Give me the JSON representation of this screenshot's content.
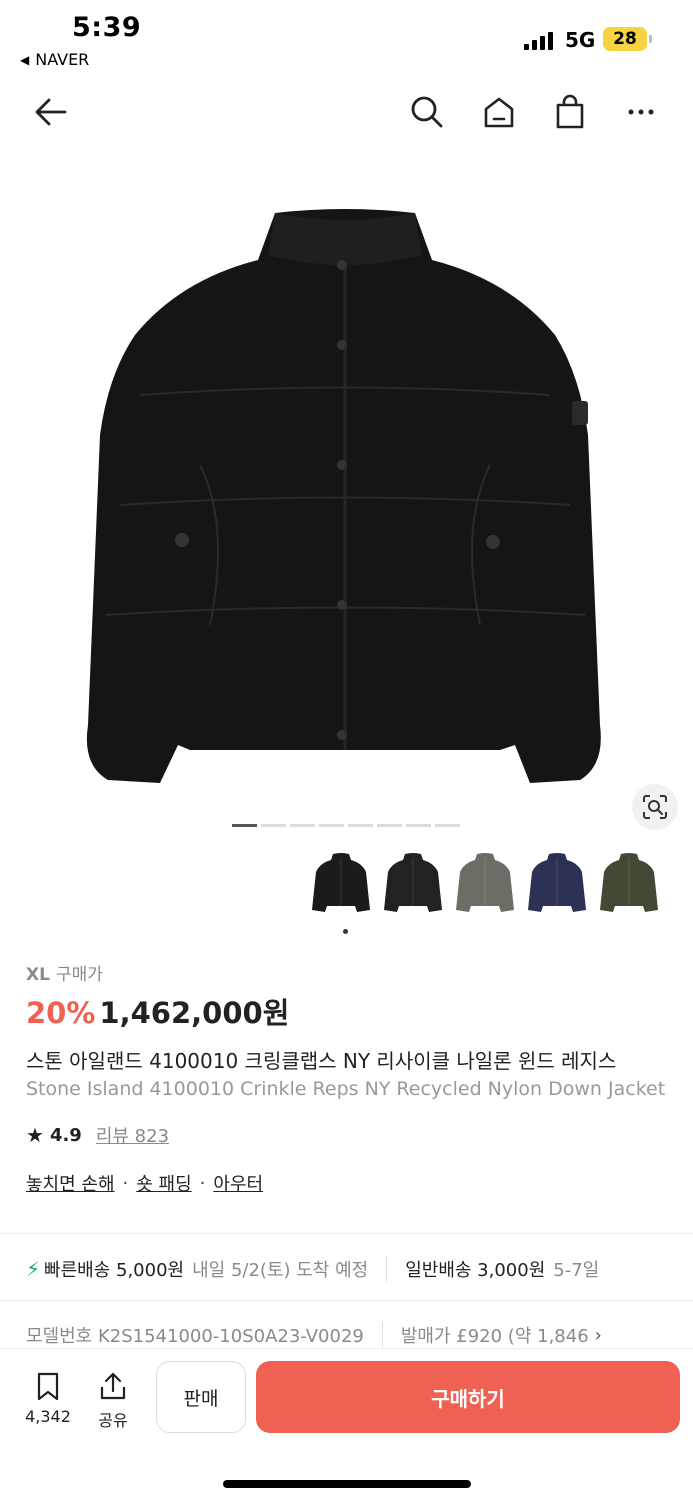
{
  "status_bar": {
    "time": "5:39",
    "back_app": "NAVER",
    "network": "5G",
    "battery": "28"
  },
  "icons": {
    "back": "arrow-left-icon",
    "search": "search-icon",
    "home": "home-icon",
    "bag": "shopping-bag-icon",
    "more": "more-icon",
    "lens": "image-search-icon",
    "bolt": "lightning-icon",
    "bookmark": "bookmark-icon",
    "share": "share-icon"
  },
  "gallery": {
    "total_pages": 8,
    "current_page": 1,
    "thumbnail_colors": [
      "#1b1b1b",
      "#222222",
      "#6c6e66",
      "#2e3156",
      "#424a35"
    ]
  },
  "product": {
    "size": "XL",
    "price_label": "구매가",
    "discount": "20%",
    "price": "1,462,000원",
    "title_ko": "스톤 아일랜드 4100010 크링클랩스 NY 리사이클 나일론 윈드 레지스",
    "title_en": "Stone Island 4100010 Crinkle Reps NY Recycled Nylon Down Jacket",
    "rating": "4.9",
    "review_label": "리뷰 823",
    "tags": [
      "놓치면 손해",
      "숏 패딩",
      "아우터"
    ],
    "tag_separator": "·"
  },
  "shipping": {
    "fast_label": "빠른배송 5,000원",
    "fast_date": "내일 5/2(토) 도착 예정",
    "normal_label": "일반배송 3,000원",
    "normal_date": "5-7일"
  },
  "model": {
    "label": "모델번호 K2S1541000-10S0A23-V0029",
    "release_price": "발매가 £920 (약 1,846",
    "chevron": "›"
  },
  "bottom_bar": {
    "save_count": "4,342",
    "share_label": "공유",
    "sell_label": "판매",
    "buy_label": "구매하기"
  },
  "colors": {
    "accent": "#ef6253",
    "bolt": "#1fb36b",
    "battery": "#f5d341"
  }
}
